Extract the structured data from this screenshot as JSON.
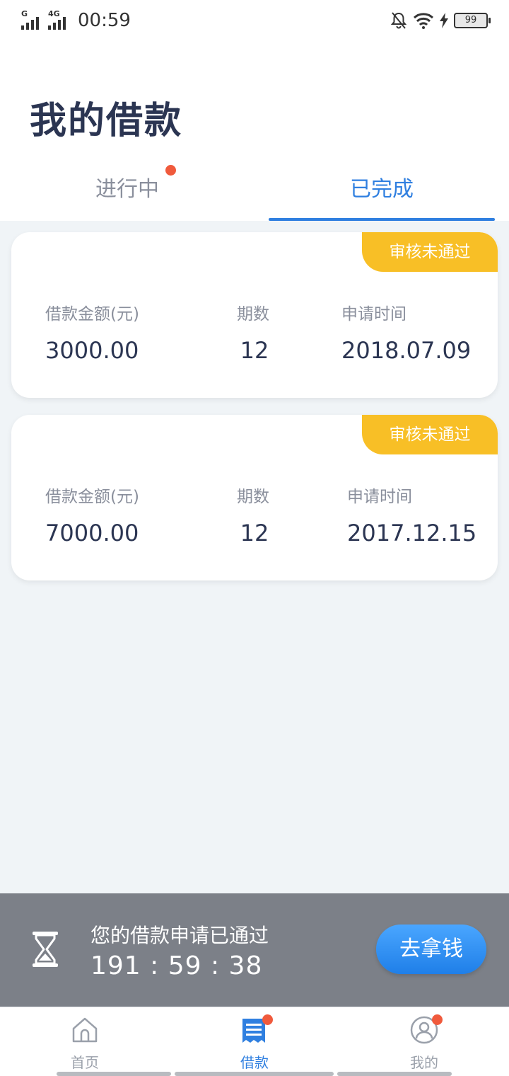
{
  "status_bar": {
    "signal1_label": "G",
    "signal2_label": "4G",
    "time": "00:59",
    "battery": "99"
  },
  "page": {
    "title": "我的借款"
  },
  "tabs": [
    {
      "label": "进行中",
      "has_dot": true,
      "active": false
    },
    {
      "label": "已完成",
      "has_dot": false,
      "active": true
    }
  ],
  "loans": [
    {
      "badge": "审核未通过",
      "amount_label": "借款金额(元)",
      "amount": "3000.00",
      "term_label": "期数",
      "term": "12",
      "date_label": "申请时间",
      "date": "2018.07.09"
    },
    {
      "badge": "审核未通过",
      "amount_label": "借款金额(元)",
      "amount": "7000.00",
      "term_label": "期数",
      "term": "12",
      "date_label": "申请时间",
      "date": "2017.12.15"
    }
  ],
  "notice": {
    "icon": "hourglass-icon",
    "text": "您的借款申请已通过",
    "countdown": "191 : 59 : 38",
    "button_label": "去拿钱"
  },
  "bottom_nav": [
    {
      "label": "首页",
      "icon": "home-icon",
      "active": false,
      "has_dot": false
    },
    {
      "label": "借款",
      "icon": "document-icon",
      "active": true,
      "has_dot": true
    },
    {
      "label": "我的",
      "icon": "user-icon",
      "active": false,
      "has_dot": true
    }
  ],
  "colors": {
    "primary": "#2f7fe0",
    "badge": "#f8bf26",
    "dot": "#f05a3c",
    "title": "#2b3552",
    "muted": "#8a8f9c",
    "notice_bg": "#7c8088"
  }
}
